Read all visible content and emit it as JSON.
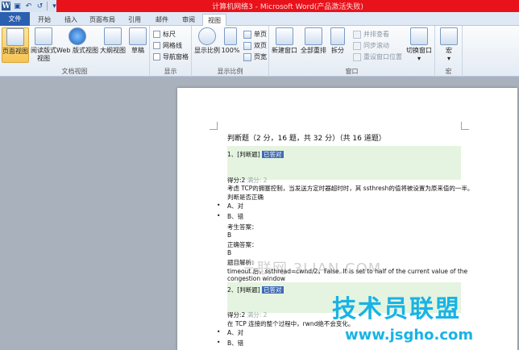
{
  "window": {
    "title": "计算机网络3 - Microsoft Word(产品激活失败)"
  },
  "qat": {
    "app_icon_letter": "W"
  },
  "tabs": [
    {
      "label": "文件"
    },
    {
      "label": "开始"
    },
    {
      "label": "插入"
    },
    {
      "label": "页面布局"
    },
    {
      "label": "引用"
    },
    {
      "label": "邮件"
    },
    {
      "label": "审阅"
    },
    {
      "label": "视图"
    }
  ],
  "ribbon": {
    "doc_views": {
      "label": "文档视图",
      "page_view": "页面视图",
      "reading_view_l1": "阅读版式",
      "reading_view_l2": "视图",
      "web_view": "Web 版式视图",
      "outline_view": "大纲视图",
      "draft_view": "草稿"
    },
    "show": {
      "label": "显示",
      "ruler": "标尺",
      "gridlines": "网格线",
      "nav_pane": "导航窗格"
    },
    "zoom": {
      "label": "显示比例",
      "zoom": "显示比例",
      "percent": "100%",
      "one_page": "单页",
      "two_pages": "双页",
      "page_width": "页宽"
    },
    "window": {
      "label": "窗口",
      "new_window": "新建窗口",
      "arrange_all": "全部重排",
      "split": "拆分",
      "side_by_side": "并排查看",
      "sync_scroll": "同步滚动",
      "reset_position": "重设窗口位置",
      "switch_windows": "切换窗口"
    },
    "macros": {
      "label": "宏",
      "macros": "宏"
    }
  },
  "document": {
    "heading": "判断题（2 分，16 题，共 32 分）（共 16 道题）",
    "q1_label": "1、[判断题]",
    "q1_tag": "已答对",
    "score1": "得分:2",
    "score1_full": "满分: 2",
    "q1_text": "考虑 TCP的拥塞控制，当发送方定时器超时时，其 ssthresh的值将被设置为原来值的一半。",
    "q1_prompt": "判断是否正确",
    "opt_a": "A、对",
    "opt_b": "B、错",
    "student_answer_label": "考生答案：",
    "student_answer": "B",
    "correct_answer_label": "正确答案：",
    "correct_answer": "B",
    "explain_label": "题目解析：",
    "explain_text": "timeout 后，ssthread=cwnd/2，False. It is set to half of the current value of the",
    "explain_text2": "congestion window",
    "q2_label": "2、[判断题]",
    "q2_tag": "已答对",
    "score2": "得分:2",
    "score2_full": "满分: 2",
    "q2_text": "在 TCP 连接的整个过程中，rwnd绝不会变化。",
    "opt_a2": "A、对",
    "opt_b2": "B、错"
  },
  "watermarks": {
    "site_cn": "三联网 3LIAN.COM",
    "brand": "技术员联盟",
    "url": "www.jsgho.com"
  }
}
